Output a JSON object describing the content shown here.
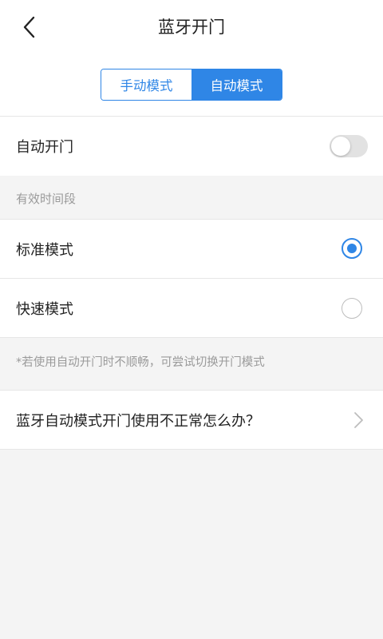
{
  "header": {
    "title": "蓝牙开门",
    "back_icon": "chevron-left-icon"
  },
  "mode_switch": {
    "manual_label": "手动模式",
    "auto_label": "自动模式",
    "selected": "auto"
  },
  "auto_open": {
    "label": "自动开门",
    "enabled": false
  },
  "valid_period": {
    "section_label": "有效时间段"
  },
  "modes": [
    {
      "label": "标准模式",
      "checked": true
    },
    {
      "label": "快速模式",
      "checked": false
    }
  ],
  "hint": {
    "text": "*若使用自动开门时不顺畅，可尝试切换开门模式"
  },
  "help": {
    "label": "蓝牙自动模式开门使用不正常怎么办？",
    "icon": "chevron-right-icon"
  },
  "colors": {
    "accent": "#2f86e6",
    "background": "#f4f4f4",
    "secondary_text": "#9a9a9a"
  }
}
